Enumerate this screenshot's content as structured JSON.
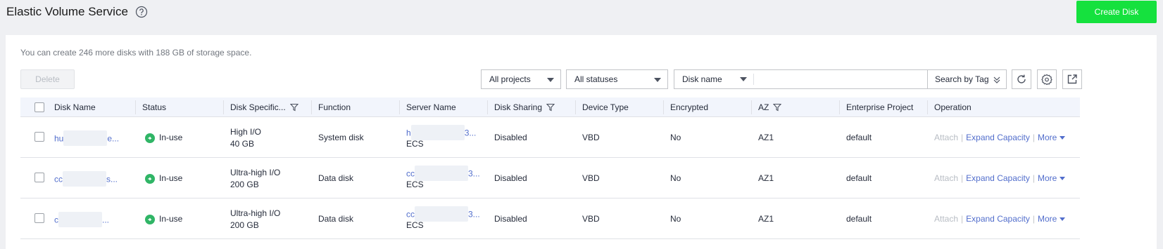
{
  "header": {
    "title": "Elastic Volume Service",
    "create_label": "Create Disk"
  },
  "quota_text": "You can create 246 more disks with 188 GB of storage space.",
  "toolbar": {
    "delete_label": "Delete",
    "project_select": "All projects",
    "status_select": "All statuses",
    "search_field": "Disk name",
    "search_placeholder": "",
    "tag_label": "Search by Tag"
  },
  "table": {
    "columns": [
      "Disk Name",
      "Status",
      "Disk Specific...",
      "Function",
      "Server Name",
      "Disk Sharing",
      "Device Type",
      "Encrypted",
      "AZ",
      "Enterprise Project",
      "Operation"
    ],
    "rows": [
      {
        "name_prefix": "hu",
        "name_suffix": "e...",
        "status": "In-use",
        "spec_type": "High I/O",
        "spec_size": "40 GB",
        "function": "System disk",
        "server_prefix": "h",
        "server_suffix": "3...",
        "server_type": "ECS",
        "sharing": "Disabled",
        "device": "VBD",
        "encrypted": "No",
        "az": "AZ1",
        "project": "default"
      },
      {
        "name_prefix": "cc",
        "name_suffix": "s...",
        "status": "In-use",
        "spec_type": "Ultra-high I/O",
        "spec_size": "200 GB",
        "function": "Data disk",
        "server_prefix": "cc",
        "server_suffix": "3...",
        "server_type": "ECS",
        "sharing": "Disabled",
        "device": "VBD",
        "encrypted": "No",
        "az": "AZ1",
        "project": "default"
      },
      {
        "name_prefix": "c",
        "name_suffix": "...",
        "status": "In-use",
        "spec_type": "Ultra-high I/O",
        "spec_size": "200 GB",
        "function": "Data disk",
        "server_prefix": "cc",
        "server_suffix": "3...",
        "server_type": "ECS",
        "sharing": "Disabled",
        "device": "VBD",
        "encrypted": "No",
        "az": "AZ1",
        "project": "default"
      }
    ],
    "operations": {
      "attach": "Attach",
      "expand": "Expand Capacity",
      "more": "More"
    }
  },
  "colors": {
    "primary": "#15e13e",
    "link": "#526ecc",
    "status_ok": "#30b566"
  }
}
